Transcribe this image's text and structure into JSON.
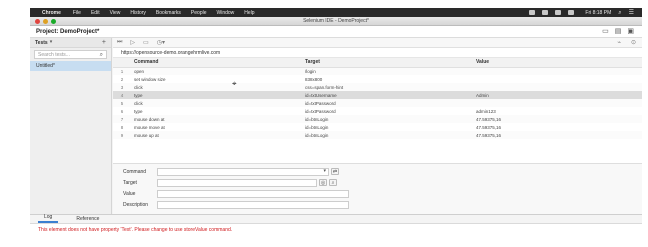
{
  "menubar": {
    "app_name": "Chrome",
    "items": [
      "File",
      "Edit",
      "View",
      "History",
      "Bookmarks",
      "People",
      "Window",
      "Help"
    ],
    "clock": "Fri 8:18 PM"
  },
  "window": {
    "title": "Selenium IDE - DemoProject*"
  },
  "project": {
    "name": "Project: DemoProject*"
  },
  "sidebar": {
    "header_label": "Tests",
    "search_placeholder": "Search tests...",
    "tests": [
      "Untitled*"
    ]
  },
  "url": "https://opensource-demo.orangehrmlive.com",
  "table": {
    "headers": {
      "command": "Command",
      "target": "Target",
      "value": "Value"
    },
    "rows": [
      {
        "num": "1",
        "command": "open",
        "target": "/login",
        "value": ""
      },
      {
        "num": "2",
        "command": "set window size",
        "target": "838x800",
        "value": ""
      },
      {
        "num": "3",
        "command": "click",
        "target": "css=span.form-hint",
        "value": ""
      },
      {
        "num": "4",
        "command": "type",
        "target": "id=txtUsername",
        "value": "Admin"
      },
      {
        "num": "5",
        "command": "click",
        "target": "id=txtPassword",
        "value": ""
      },
      {
        "num": "6",
        "command": "type",
        "target": "id=txtPassword",
        "value": "admin123"
      },
      {
        "num": "7",
        "command": "mouse down at",
        "target": "id=btnLogin",
        "value": "47.59375,16"
      },
      {
        "num": "8",
        "command": "mouse move at",
        "target": "id=btnLogin",
        "value": "47.59375,16"
      },
      {
        "num": "9",
        "command": "mouse up at",
        "target": "id=btnLogin",
        "value": "47.59375,16"
      }
    ],
    "selected_row": 4
  },
  "editor": {
    "command_label": "Command",
    "target_label": "Target",
    "value_label": "Value",
    "description_label": "Description"
  },
  "log": {
    "tabs": [
      "Log",
      "Reference"
    ],
    "active_tab": "Log",
    "message": "This element does not have property 'Text'. Please change to use storeValue command."
  }
}
